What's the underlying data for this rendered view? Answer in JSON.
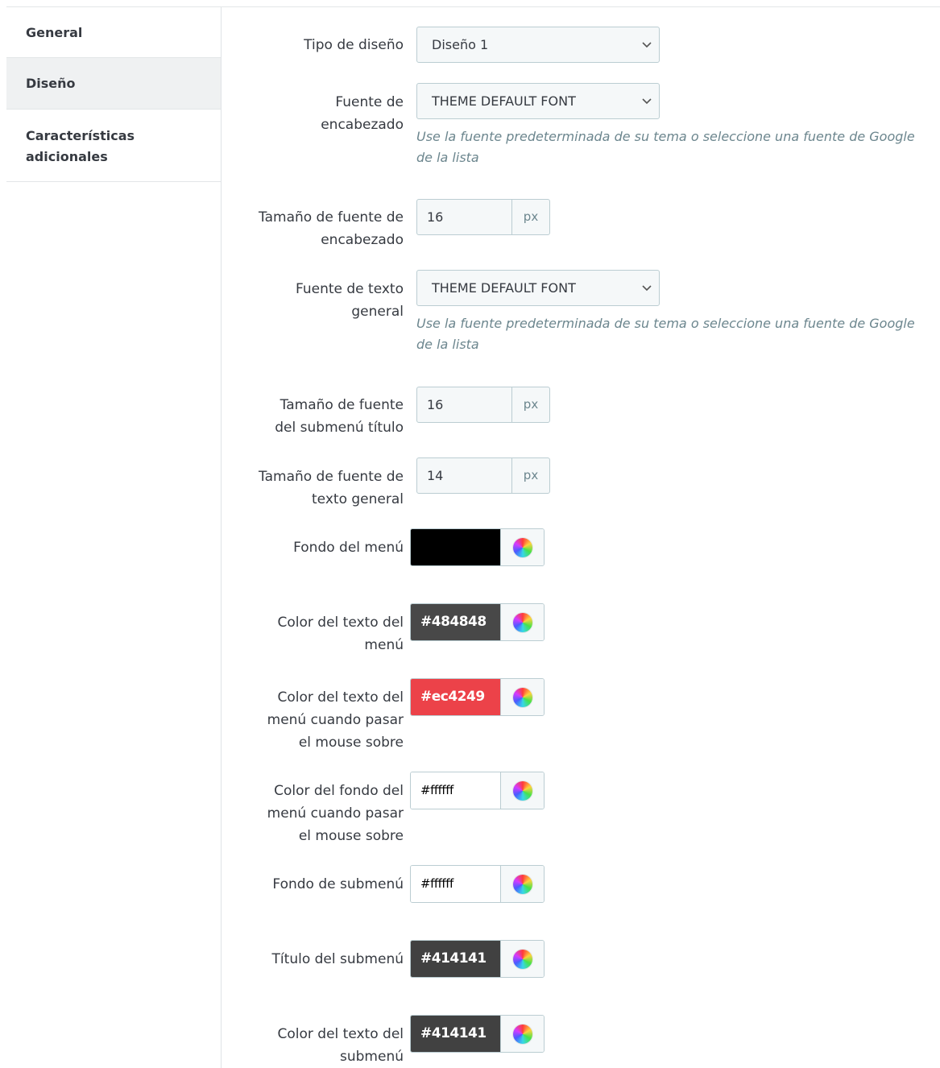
{
  "sidebar": {
    "tabs": [
      {
        "label": "General",
        "active": false
      },
      {
        "label": "Diseño",
        "active": true
      },
      {
        "label": "Características\nadicionales",
        "active": false
      }
    ]
  },
  "form": {
    "layout_type": {
      "label": "Tipo de diseño",
      "value": "Diseño 1"
    },
    "heading_font": {
      "label": "Fuente de\nencabezado",
      "value": "THEME DEFAULT FONT",
      "help": "Use la fuente predeterminada de su tema o seleccione una fuente de Google de la lista"
    },
    "heading_font_size": {
      "label": "Tamaño de fuente de\nencabezado",
      "value": "16",
      "unit": "px"
    },
    "general_font": {
      "label": "Fuente de texto\ngeneral",
      "value": "THEME DEFAULT FONT",
      "help": "Use la fuente predeterminada de su tema o seleccione una fuente de Google de la lista"
    },
    "submenu_title_font_size": {
      "label": "Tamaño de fuente\ndel submenú título",
      "value": "16",
      "unit": "px"
    },
    "general_text_font_size": {
      "label": "Tamaño de fuente de\ntexto general",
      "value": "14",
      "unit": "px"
    },
    "menu_background": {
      "label": "Fondo del menú",
      "value": "",
      "color": "#000000",
      "text_color": "#ffffff"
    },
    "menu_text_color": {
      "label": "Color del texto del\nmenú",
      "value": "#484848",
      "color": "#484848",
      "text_color": "#ffffff"
    },
    "menu_text_hover_color": {
      "label": "Color del texto del\nmenú cuando pasar\nel mouse sobre",
      "value": "#ec4249",
      "color": "#ec4249",
      "text_color": "#ffffff"
    },
    "menu_bg_hover_color": {
      "label": "Color del fondo del\nmenú cuando pasar\nel mouse sobre",
      "value": "#ffffff",
      "color": "#ffffff",
      "text_color": "#000000"
    },
    "submenu_background": {
      "label": "Fondo de submenú",
      "value": "#ffffff",
      "color": "#ffffff",
      "text_color": "#000000"
    },
    "submenu_title": {
      "label": "Título del submenú",
      "value": "#414141",
      "color": "#414141",
      "text_color": "#ffffff"
    },
    "submenu_text_color": {
      "label": "Color del texto del\nsubmenú",
      "value": "#414141",
      "color": "#414141",
      "text_color": "#ffffff"
    }
  }
}
